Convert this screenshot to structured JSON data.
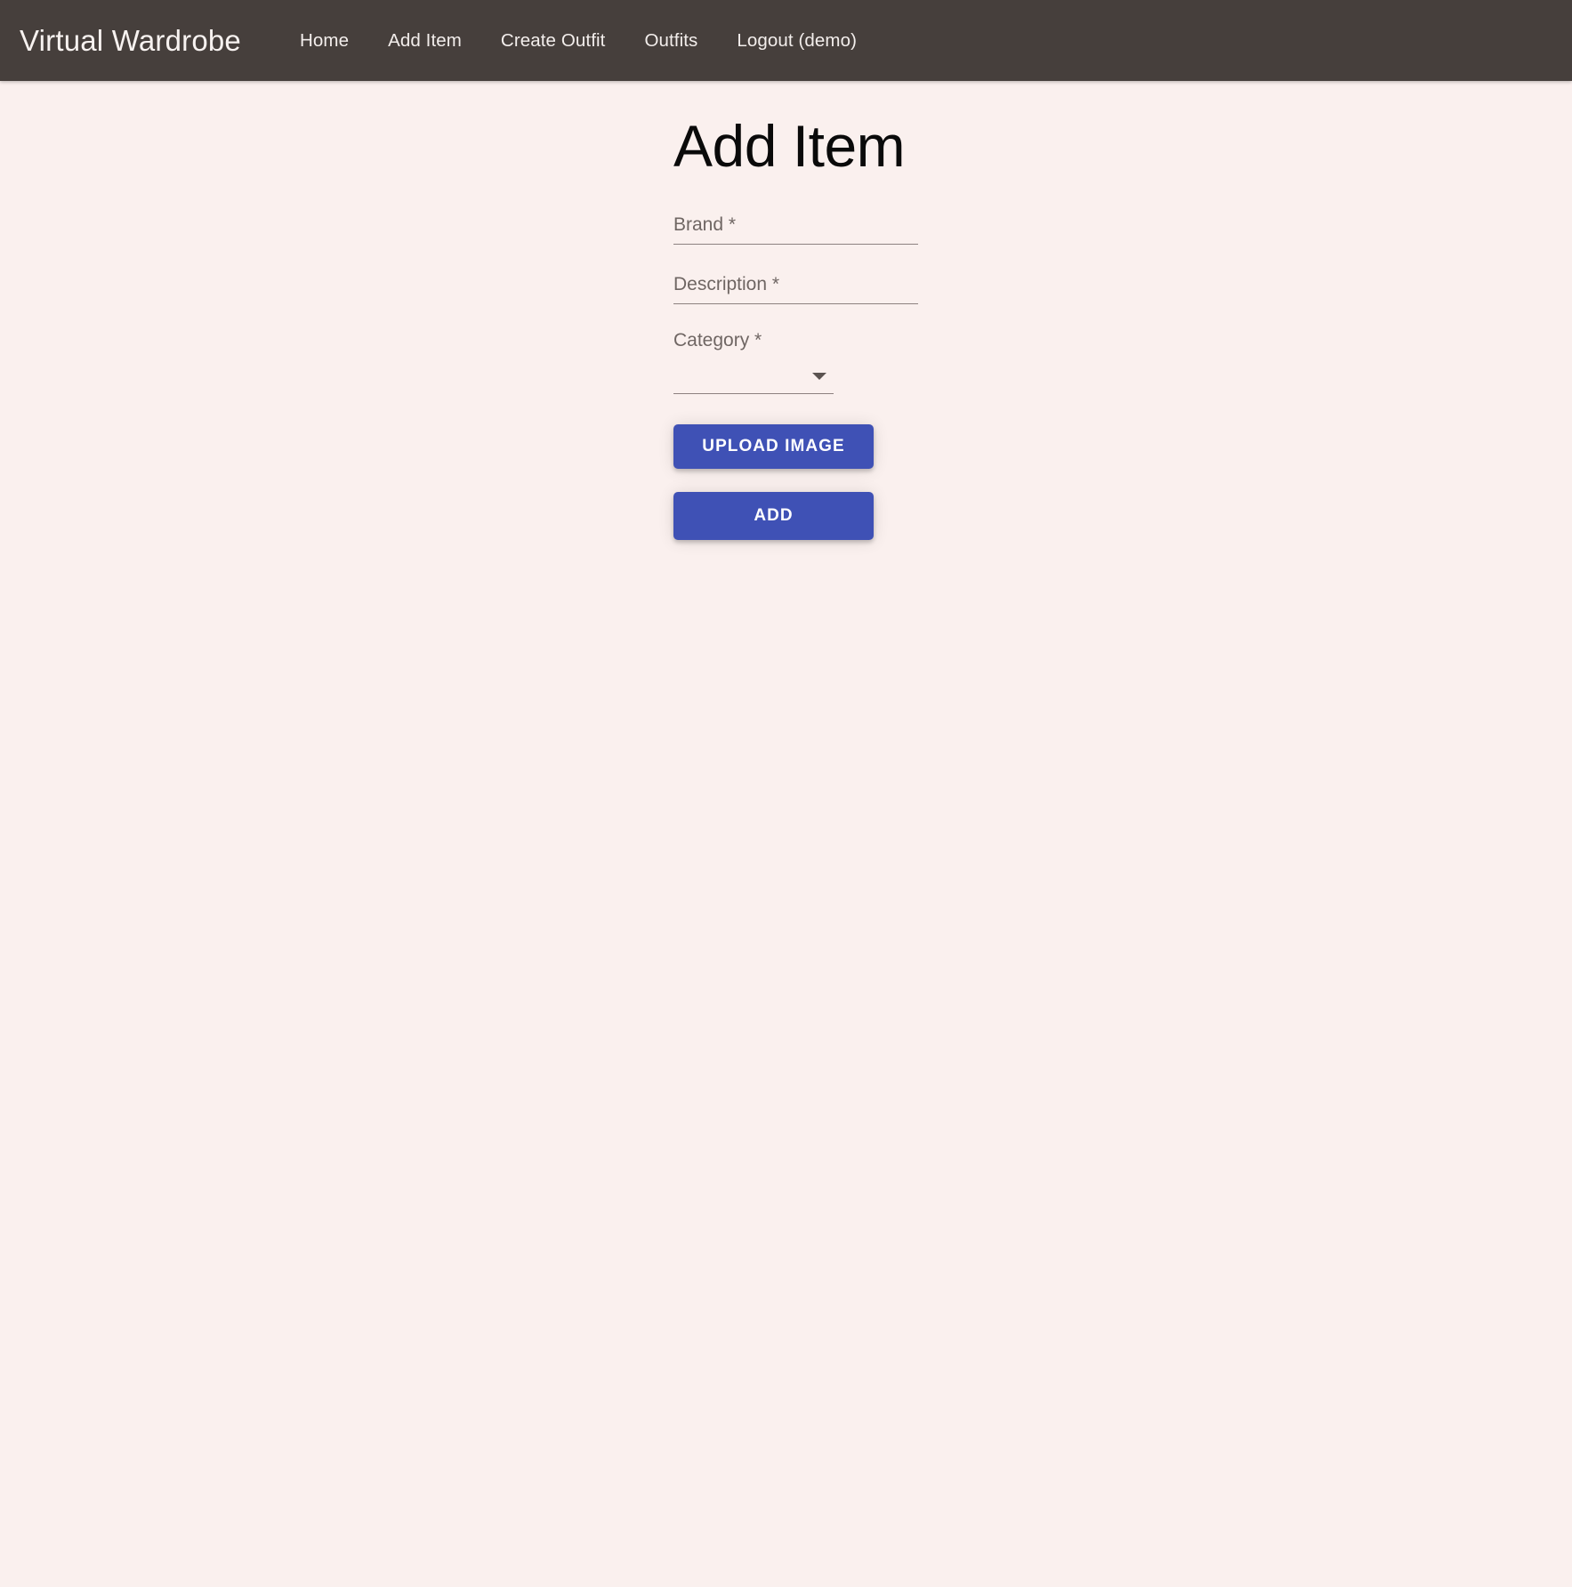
{
  "navbar": {
    "brand": "Virtual Wardrobe",
    "links": [
      {
        "label": "Home",
        "name": "nav-link-home"
      },
      {
        "label": "Add Item",
        "name": "nav-link-add-item"
      },
      {
        "label": "Create Outfit",
        "name": "nav-link-create-outfit"
      },
      {
        "label": "Outfits",
        "name": "nav-link-outfits"
      },
      {
        "label": "Logout (demo)",
        "name": "nav-link-logout"
      }
    ],
    "background_color": "#463f3c",
    "text_color": "#f3eeec"
  },
  "page": {
    "title": "Add Item",
    "background_color": "#faf0ee"
  },
  "form": {
    "brand_field": {
      "placeholder": "Brand *",
      "value": ""
    },
    "description_field": {
      "placeholder": "Description *",
      "value": ""
    },
    "category_field": {
      "label": "Category *",
      "value": "",
      "arrow_icon": "chevron-down-icon"
    },
    "upload_button": {
      "label": "UPLOAD IMAGE"
    },
    "add_button": {
      "label": "ADD"
    },
    "button_color": "#3f51b5",
    "underline_color": "#8d8180"
  }
}
